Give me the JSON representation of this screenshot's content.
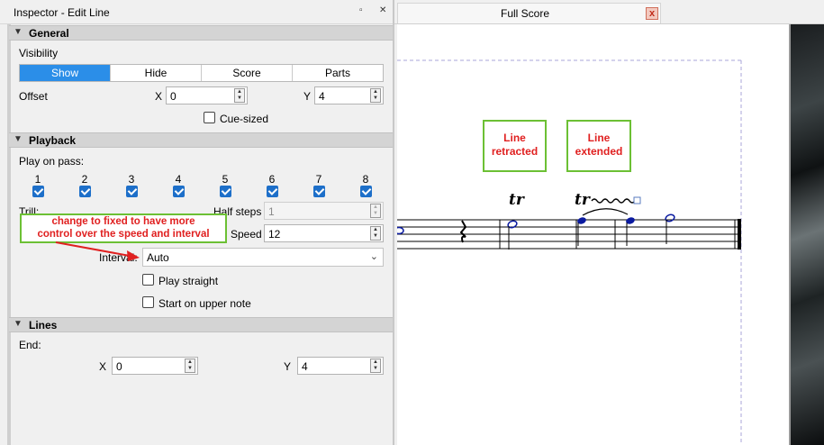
{
  "inspector": {
    "title": "Inspector - Edit Line",
    "float_icon": "▫",
    "close_icon": "✕",
    "general": {
      "header": "General",
      "visibility_label": "Visibility",
      "visibility_options": [
        "Show",
        "Hide",
        "Score",
        "Parts"
      ],
      "visibility_selected": "Show",
      "offset_label": "Offset",
      "x_label": "X",
      "x_value": "0",
      "y_label": "Y",
      "y_value": "4",
      "cue_sized_label": "Cue-sized",
      "cue_sized_checked": false
    },
    "playback": {
      "header": "Playback",
      "play_on_pass_label": "Play on pass:",
      "passes": [
        "1",
        "2",
        "3",
        "4",
        "5",
        "6",
        "7",
        "8"
      ],
      "trill_label": "Trill:",
      "half_steps_label": "Half steps",
      "half_steps_value": "1",
      "speed_label": "Speed",
      "speed_value": "12",
      "interval_label": "Interval:",
      "interval_value": "Auto",
      "play_straight_label": "Play straight",
      "start_upper_label": "Start on upper note"
    },
    "lines": {
      "header": "Lines",
      "end_label": "End:",
      "x_label": "X",
      "x_value": "0",
      "y_label": "Y",
      "y_value": "4"
    },
    "annotation": {
      "line1": "change to fixed to have more",
      "line2": "control over the speed and interval"
    }
  },
  "score": {
    "tab_label": "Full Score",
    "close_icon": "x",
    "note_retracted": [
      "Line",
      "retracted"
    ],
    "note_extended": [
      "Line",
      "extended"
    ],
    "trill_symbol": "tr"
  },
  "colors": {
    "accent": "#2b8ee8",
    "annotation_red": "#e02020",
    "annotation_green": "#6cc034",
    "selected_note": "#0a1aa0"
  }
}
